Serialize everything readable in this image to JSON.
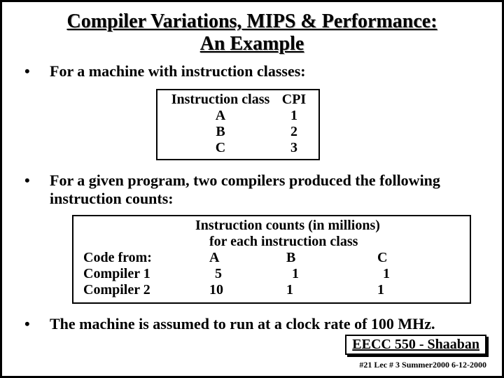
{
  "title_line1": "Compiler Variations, MIPS & Performance:",
  "title_line2": "An Example",
  "bullet1": "For a machine with instruction classes:",
  "bullet2": "For a given program, two compilers produced the following instruction counts:",
  "bullet3": "The machine is assumed to run at a clock rate of 100 MHz.",
  "table1": {
    "h1": "Instruction class",
    "h2": "CPI",
    "r1c1": "A",
    "r1c2": "1",
    "r2c1": "B",
    "r2c2": "2",
    "r3c1": "C",
    "r3c2": "3"
  },
  "table2": {
    "hdr1": "Instruction counts (in millions)",
    "hdr2": "for each  instruction class",
    "code_from": "Code  from:",
    "colA": "A",
    "colB": "B",
    "colC": "C",
    "row1_lbl": "Compiler 1",
    "row1_a": "5",
    "row1_b": "1",
    "row1_c": "1",
    "row2_lbl": "Compiler 2",
    "row2_a": "10",
    "row2_b": "1",
    "row2_c": "1"
  },
  "footer_course": "EECC 550 - Shaaban",
  "footer_small": "#21   Lec # 3    Summer2000   6-12-2000"
}
